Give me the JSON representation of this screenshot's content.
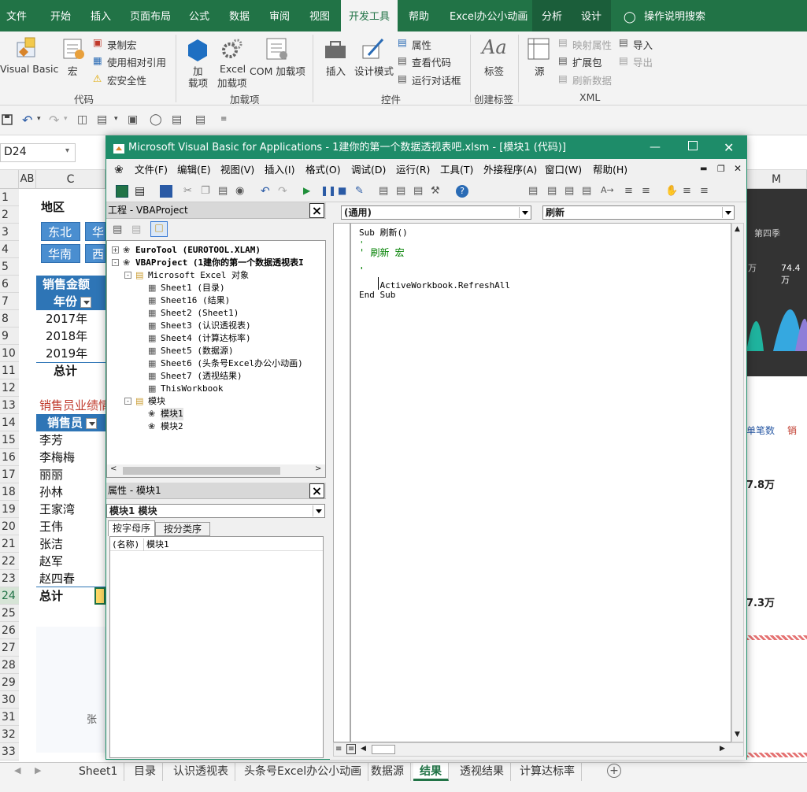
{
  "ribbon_tabs": [
    "文件",
    "开始",
    "插入",
    "页面布局",
    "公式",
    "数据",
    "审阅",
    "视图",
    "开发工具",
    "帮助",
    "Excel办公小动画",
    "分析",
    "设计"
  ],
  "tell_me": "操作说明搜索",
  "ribbon": {
    "code": {
      "visual_basic": "Visual Basic",
      "macros": "宏",
      "record": "录制宏",
      "relative": "使用相对引用",
      "security": "宏安全性",
      "group": "代码"
    },
    "addins": {
      "addins_line1": "加",
      "addins_line2": "载项",
      "excel_addins_line1": "Excel",
      "excel_addins_line2": "加载项",
      "com_addins": "COM 加载项",
      "group": "加载项"
    },
    "controls": {
      "insert": "插入",
      "design_mode": "设计模式",
      "properties": "属性",
      "view_code": "查看代码",
      "run_dialog": "运行对话框",
      "group": "控件"
    },
    "tags": {
      "label": "标签",
      "group": "创建标签"
    },
    "xml": {
      "source": "源",
      "map_properties": "映射属性",
      "expansion": "扩展包",
      "refresh": "刷新数据",
      "import": "导入",
      "export": "导出",
      "group": "XML"
    }
  },
  "name_box": "D24",
  "columns": [
    "AB",
    "C",
    "M"
  ],
  "rows": [
    "1",
    "2",
    "3",
    "4",
    "5",
    "6",
    "7",
    "8",
    "9",
    "10",
    "11",
    "12",
    "13",
    "14",
    "15",
    "16",
    "17",
    "18",
    "19",
    "20",
    "21",
    "22",
    "23",
    "24",
    "25",
    "26",
    "27",
    "28",
    "29",
    "30",
    "31",
    "32",
    "33"
  ],
  "sheet": {
    "region_label": "地区",
    "slicer_items": [
      "东北",
      "华",
      "华南",
      "西"
    ],
    "sales_header": "销售金额",
    "year_header": "年份",
    "years": [
      "2017年",
      "2018年",
      "2019年"
    ],
    "total": "总计",
    "perf_title": "销售员业绩情",
    "seller_header": "销售员",
    "sellers": [
      "李芳",
      "李梅梅",
      "丽丽",
      "孙林",
      "王家湾",
      "王伟",
      "张洁",
      "赵军",
      "赵四春"
    ],
    "total2": "总计",
    "note": "张"
  },
  "right_panel": {
    "quarter": "第四季",
    "val1": "74.4万",
    "val2": "万",
    "legend1": "单笔数",
    "legend2": "销",
    "big1": "7.8万",
    "big2": "7.3万"
  },
  "sheet_tabs": [
    "Sheet1",
    "目录",
    "认识透视表",
    "头条号Excel办公小动画",
    "数据源",
    "结果",
    "透视结果",
    "计算达标率"
  ],
  "active_sheet": "结果",
  "vba": {
    "title": "Microsoft Visual Basic for Applications - 1建你的第一个数据透视表吧.xlsm - [模块1 (代码)]",
    "menu": [
      "文件(F)",
      "编辑(E)",
      "视图(V)",
      "插入(I)",
      "格式(O)",
      "调试(D)",
      "运行(R)",
      "工具(T)",
      "外接程序(A)",
      "窗口(W)",
      "帮助(H)"
    ],
    "project_title": "工程 - VBAProject",
    "tree": [
      {
        "text": "EuroTool (EUROTOOL.XLAM)",
        "level": 0,
        "bold": true,
        "exp": "+"
      },
      {
        "text": "VBAProject (1建你的第一个数据透视表I",
        "level": 0,
        "bold": true,
        "exp": "-"
      },
      {
        "text": "Microsoft Excel 对象",
        "level": 1,
        "bold": false,
        "exp": "-",
        "folder": true
      },
      {
        "text": "Sheet1 (目录)",
        "level": 2
      },
      {
        "text": "Sheet16 (结果)",
        "level": 2
      },
      {
        "text": "Sheet2 (Sheet1)",
        "level": 2
      },
      {
        "text": "Sheet3 (认识透视表)",
        "level": 2
      },
      {
        "text": "Sheet4 (计算达标率)",
        "level": 2
      },
      {
        "text": "Sheet5 (数据源)",
        "level": 2
      },
      {
        "text": "Sheet6 (头条号Excel办公小动画)",
        "level": 2
      },
      {
        "text": "Sheet7 (透视结果)",
        "level": 2
      },
      {
        "text": "ThisWorkbook",
        "level": 2
      },
      {
        "text": "模块",
        "level": 1,
        "exp": "-",
        "folder": true
      },
      {
        "text": "模块1",
        "level": 2,
        "module": true
      },
      {
        "text": "模块2",
        "level": 2,
        "module": true
      }
    ],
    "props_title": "属性 - 模块1",
    "props_object": "模块1 模块",
    "props_tabs": [
      "按字母序",
      "按分类序"
    ],
    "props_row_name": "(名称)",
    "props_row_value": "模块1",
    "combo_general": "(通用)",
    "combo_proc": "刷新",
    "code_lines": [
      "Sub 刷新()",
      "'",
      "' 刷新 宏",
      "'",
      "'",
      "    ActiveWorkbook.RefreshAll",
      "End Sub"
    ]
  }
}
